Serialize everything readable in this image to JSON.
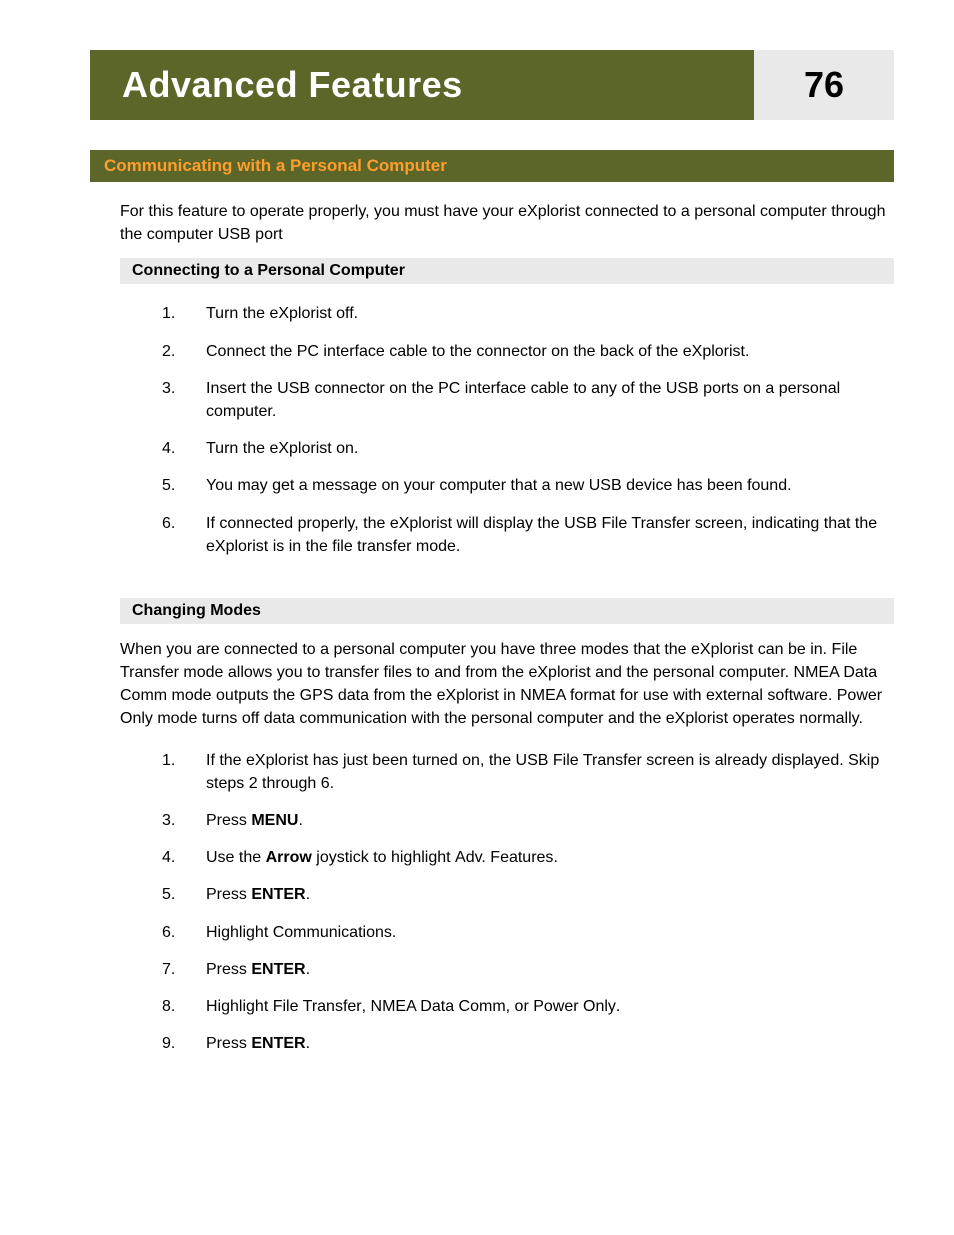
{
  "header": {
    "title": "Advanced Features",
    "page": "76"
  },
  "section": {
    "heading": "Communicating with a Personal Computer",
    "intro": "For this feature to operate properly, you must have your eXplorist connected to a personal computer through the computer USB port"
  },
  "connecting": {
    "heading": "Connecting to a Personal Computer",
    "steps": [
      {
        "n": "1.",
        "t": "Turn the eXplorist off."
      },
      {
        "n": "2.",
        "t": "Connect the PC interface cable to the connector on the back of the eXplorist."
      },
      {
        "n": "3.",
        "t": "Insert the USB connector on the PC interface cable to any of the USB ports on a personal computer."
      },
      {
        "n": "4.",
        "t": "Turn the eXplorist on."
      },
      {
        "n": "5.",
        "t": "You may get a message on your computer that a new USB device has been found."
      },
      {
        "n": "6.",
        "t": "If connected properly, the eXplorist will display the USB File Transfer screen, indicating that the eXplorist is in the file transfer mode."
      }
    ]
  },
  "changing": {
    "heading": "Changing Modes",
    "intro": "When you are connected to a personal computer you have three modes that the eXplorist can be in.  File Transfer mode allows you to transfer files to and from the eXplorist and the personal computer.  NMEA Data Comm mode outputs the GPS data from the eXplorist in NMEA format for use with external software.  Power Only mode turns off data communication with the personal computer and the eXplorist operates normally.",
    "steps": {
      "s1": {
        "n": "1.",
        "t": "If the eXplorist has just been turned on, the USB File Transfer screen is already displayed.  Skip steps 2 through 6."
      },
      "s3": {
        "n": "3.",
        "pre": "Press ",
        "b": "MENU",
        "post": "."
      },
      "s4": {
        "n": "4.",
        "pre": "Use the ",
        "b": "Arrow",
        "mid": " joystick to highlight ",
        "u": "Adv. Features",
        "post": "."
      },
      "s5": {
        "n": "5.",
        "pre": "Press ",
        "b": "ENTER",
        "post": "."
      },
      "s6": {
        "n": "6.",
        "pre": "Highlight ",
        "u": "Communications",
        "post": "."
      },
      "s7": {
        "n": "7.",
        "pre": "Press ",
        "b": "ENTER",
        "post": "."
      },
      "s8": {
        "n": "8.",
        "pre": "Highlight ",
        "u1": "File Transfer",
        "c1": ", ",
        "u2": "NMEA Data Comm",
        "c2": ", or ",
        "u3": "Power Only",
        "post": "."
      },
      "s9": {
        "n": "9.",
        "pre": "Press ",
        "b": "ENTER",
        "post": "."
      }
    }
  }
}
